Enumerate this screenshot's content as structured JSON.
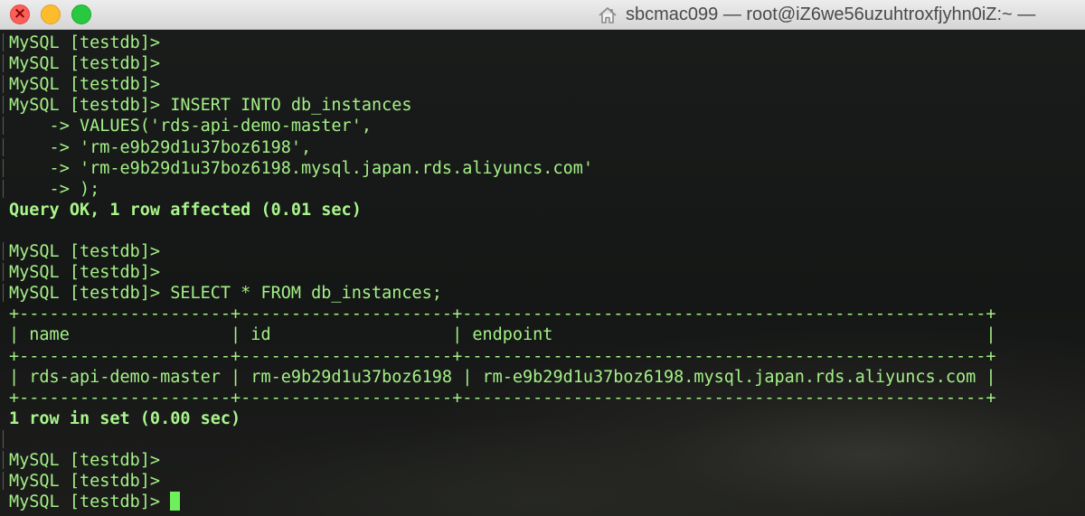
{
  "window": {
    "title": "sbcmac099 — root@iZ6we56uzuhtroxfjyhn0iZ:~ —",
    "title_icon": "home-icon",
    "buttons": [
      "close",
      "minimize",
      "zoom"
    ]
  },
  "terminal": {
    "prompt": "MySQL [testdb]> ",
    "lines": [
      "MySQL [testdb]>",
      "MySQL [testdb]>",
      "MySQL [testdb]>",
      "MySQL [testdb]> INSERT INTO db_instances",
      "    -> VALUES('rds-api-demo-master',",
      "    -> 'rm-e9b29d1u37boz6198',",
      "    -> 'rm-e9b29d1u37boz6198.mysql.japan.rds.aliyuncs.com'",
      "    -> );",
      "Query OK, 1 row affected (0.01 sec)",
      "",
      "MySQL [testdb]>",
      "MySQL [testdb]>",
      "MySQL [testdb]> SELECT * FROM db_instances;",
      "+---------------------+---------------------+----------------------------------------------------+",
      "| name                | id                  | endpoint                                           |",
      "+---------------------+---------------------+----------------------------------------------------+",
      "| rds-api-demo-master | rm-e9b29d1u37boz6198 | rm-e9b29d1u37boz6198.mysql.japan.rds.aliyuncs.com |",
      "+---------------------+---------------------+----------------------------------------------------+",
      "1 row in set (0.00 sec)",
      "",
      "MySQL [testdb]>",
      "MySQL [testdb]>",
      "MySQL [testdb]> "
    ],
    "result_table": {
      "columns": [
        "name",
        "id",
        "endpoint"
      ],
      "rows": [
        [
          "rds-api-demo-master",
          "rm-e9b29d1u37boz6198",
          "rm-e9b29d1u37boz6198.mysql.japan.rds.aliyuncs.com"
        ]
      ]
    },
    "colors": {
      "text": "#a4f087",
      "cursor": "#6df05a",
      "background": "#151716"
    }
  }
}
